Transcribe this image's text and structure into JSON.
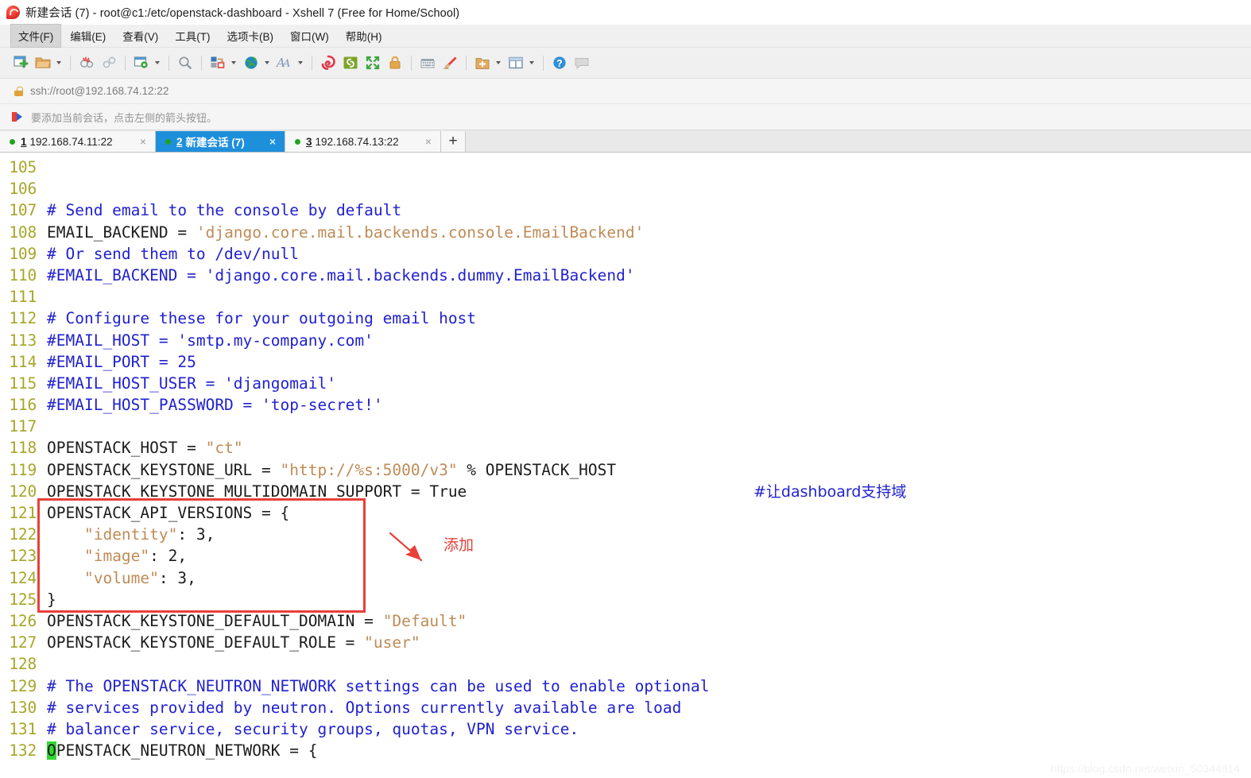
{
  "window": {
    "title": "新建会话 (7) - root@c1:/etc/openstack-dashboard - Xshell 7 (Free for Home/School)",
    "logo_name": "xshell-logo"
  },
  "menubar": {
    "items": [
      {
        "label": "文件(F)",
        "active": true
      },
      {
        "label": "编辑(E)",
        "active": false
      },
      {
        "label": "查看(V)",
        "active": false
      },
      {
        "label": "工具(T)",
        "active": false
      },
      {
        "label": "选项卡(B)",
        "active": false
      },
      {
        "label": "窗口(W)",
        "active": false
      },
      {
        "label": "帮助(H)",
        "active": false
      }
    ]
  },
  "toolbar": {
    "buttons": [
      {
        "name": "new-session-icon",
        "caret": false
      },
      {
        "name": "open-folder-icon",
        "caret": true
      },
      {
        "name": "disconnect-icon",
        "caret": false
      },
      {
        "name": "reconnect-icon",
        "caret": false
      },
      {
        "name": "session-properties-icon",
        "caret": true
      },
      {
        "name": "find-icon",
        "caret": false
      },
      {
        "name": "file-transfer-icon",
        "caret": true
      },
      {
        "name": "web-globe-icon",
        "caret": true
      },
      {
        "name": "font-icon",
        "caret": true
      },
      {
        "name": "log-icon",
        "caret": false
      },
      {
        "name": "script-icon",
        "caret": false
      },
      {
        "name": "fullscreen-icon",
        "caret": false
      },
      {
        "name": "lock-icon",
        "caret": false
      },
      {
        "name": "keyboard-icon",
        "caret": false
      },
      {
        "name": "highlight-icon",
        "caret": false
      },
      {
        "name": "add-session-icon",
        "caret": true
      },
      {
        "name": "layout-icon",
        "caret": true
      },
      {
        "name": "help-icon",
        "caret": false
      },
      {
        "name": "comment-icon",
        "caret": false
      }
    ]
  },
  "urlbar": {
    "lock_icon": "lock-icon",
    "address": "ssh://root@192.168.74.12:22"
  },
  "hintbar": {
    "icon": "bookmark-arrow-icon",
    "text": "要添加当前会话，点击左侧的箭头按钮。"
  },
  "tabs": {
    "items": [
      {
        "index": "1",
        "label": "192.168.74.11:22",
        "active": false,
        "close": "×",
        "status_dot": "#21a321"
      },
      {
        "index": "2",
        "label": "新建会话 (7)",
        "active": true,
        "close": "×",
        "status_dot": "#21a321"
      },
      {
        "index": "3",
        "label": "192.168.74.13:22",
        "active": false,
        "close": "×",
        "status_dot": "#21a321"
      }
    ],
    "add_label": "+"
  },
  "terminal": {
    "colors": {
      "background": "#ffffff",
      "line_number": "#a6a629",
      "plain": "#1c1c1c",
      "comment": "#2121cf",
      "string": "#bf8b56",
      "cursor": "#32d732"
    },
    "lines": [
      {
        "n": "105",
        "parts": []
      },
      {
        "n": "106",
        "parts": []
      },
      {
        "n": "107",
        "parts": [
          {
            "t": "# Send email to the console by default",
            "c": "comment"
          }
        ]
      },
      {
        "n": "108",
        "parts": [
          {
            "t": "EMAIL_BACKEND = ",
            "c": "plain"
          },
          {
            "t": "'django.core.mail.backends.console.EmailBackend'",
            "c": "string"
          }
        ]
      },
      {
        "n": "109",
        "parts": [
          {
            "t": "# Or send them to /dev/null",
            "c": "comment"
          }
        ]
      },
      {
        "n": "110",
        "parts": [
          {
            "t": "#EMAIL_BACKEND = 'django.core.mail.backends.dummy.EmailBackend'",
            "c": "comment"
          }
        ]
      },
      {
        "n": "111",
        "parts": []
      },
      {
        "n": "112",
        "parts": [
          {
            "t": "# Configure these for your outgoing email host",
            "c": "comment"
          }
        ]
      },
      {
        "n": "113",
        "parts": [
          {
            "t": "#EMAIL_HOST = 'smtp.my-company.com'",
            "c": "comment"
          }
        ]
      },
      {
        "n": "114",
        "parts": [
          {
            "t": "#EMAIL_PORT = 25",
            "c": "comment"
          }
        ]
      },
      {
        "n": "115",
        "parts": [
          {
            "t": "#EMAIL_HOST_USER = 'djangomail'",
            "c": "comment"
          }
        ]
      },
      {
        "n": "116",
        "parts": [
          {
            "t": "#EMAIL_HOST_PASSWORD = 'top-secret!'",
            "c": "comment"
          }
        ]
      },
      {
        "n": "117",
        "parts": []
      },
      {
        "n": "118",
        "parts": [
          {
            "t": "OPENSTACK_HOST = ",
            "c": "plain"
          },
          {
            "t": "\"ct\"",
            "c": "string"
          }
        ]
      },
      {
        "n": "119",
        "parts": [
          {
            "t": "OPENSTACK_KEYSTONE_URL = ",
            "c": "plain"
          },
          {
            "t": "\"http://%s:5000/v3\"",
            "c": "string"
          },
          {
            "t": " % OPENSTACK_HOST",
            "c": "plain"
          }
        ]
      },
      {
        "n": "120",
        "parts": [
          {
            "t": "OPENSTACK_KEYSTONE_MULTIDOMAIN_SUPPORT = True",
            "c": "plain"
          }
        ]
      },
      {
        "n": "121",
        "parts": [
          {
            "t": "OPENSTACK_API_VERSIONS = {",
            "c": "plain"
          }
        ]
      },
      {
        "n": "122",
        "parts": [
          {
            "t": "    ",
            "c": "plain"
          },
          {
            "t": "\"identity\"",
            "c": "string"
          },
          {
            "t": ": 3,",
            "c": "plain"
          }
        ]
      },
      {
        "n": "123",
        "parts": [
          {
            "t": "    ",
            "c": "plain"
          },
          {
            "t": "\"image\"",
            "c": "string"
          },
          {
            "t": ": 2,",
            "c": "plain"
          }
        ]
      },
      {
        "n": "124",
        "parts": [
          {
            "t": "    ",
            "c": "plain"
          },
          {
            "t": "\"volume\"",
            "c": "string"
          },
          {
            "t": ": 3,",
            "c": "plain"
          }
        ]
      },
      {
        "n": "125",
        "parts": [
          {
            "t": "}",
            "c": "plain"
          }
        ]
      },
      {
        "n": "126",
        "parts": [
          {
            "t": "OPENSTACK_KEYSTONE_DEFAULT_DOMAIN = ",
            "c": "plain"
          },
          {
            "t": "\"Default\"",
            "c": "string"
          }
        ]
      },
      {
        "n": "127",
        "parts": [
          {
            "t": "OPENSTACK_KEYSTONE_DEFAULT_ROLE = ",
            "c": "plain"
          },
          {
            "t": "\"user\"",
            "c": "string"
          }
        ]
      },
      {
        "n": "128",
        "parts": []
      },
      {
        "n": "129",
        "parts": [
          {
            "t": "# The OPENSTACK_NEUTRON_NETWORK settings can be used to enable optional",
            "c": "comment"
          }
        ]
      },
      {
        "n": "130",
        "parts": [
          {
            "t": "# services provided by neutron. Options currently available are load",
            "c": "comment"
          }
        ]
      },
      {
        "n": "131",
        "parts": [
          {
            "t": "# balancer service, security groups, quotas, VPN service.",
            "c": "comment"
          }
        ]
      },
      {
        "n": "132",
        "parts": [
          {
            "t": "O",
            "c": "cursor"
          },
          {
            "t": "PENSTACK_NEUTRON_NETWORK = {",
            "c": "plain"
          }
        ]
      }
    ]
  },
  "annotations": {
    "domain_note": "#让dashboard支持域",
    "add_note": "添加",
    "arrow_name": "red-arrow-annotation",
    "redbox_name": "red-highlight-box"
  },
  "watermark": {
    "text": "https://blog.csdn.net/weixin_50344814"
  }
}
